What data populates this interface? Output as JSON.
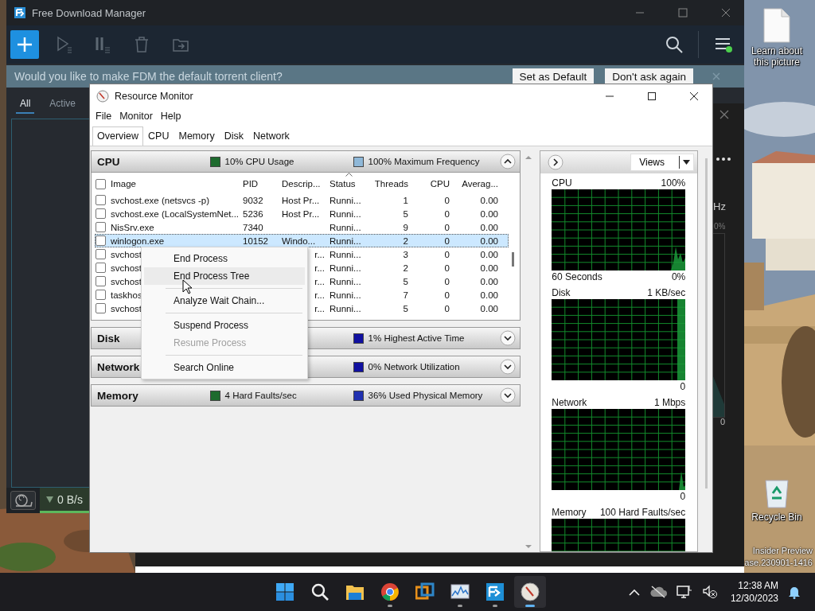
{
  "desktop": {
    "icons": [
      {
        "kind": "file",
        "label": "Learn about this picture"
      },
      {
        "kind": "recycle",
        "label": "Recycle Bin"
      }
    ],
    "build_info": [
      "Insider Preview",
      "ase.230901-1416"
    ]
  },
  "fdm": {
    "title": "Free Download Manager",
    "toolbar": [
      {
        "kind": "add",
        "disabled": false
      },
      {
        "kind": "play",
        "disabled": true
      },
      {
        "kind": "pause",
        "disabled": true
      },
      {
        "kind": "delete",
        "disabled": true
      },
      {
        "kind": "folder",
        "disabled": true
      }
    ],
    "menu_notification": true,
    "banner": {
      "text": "Would you like to make FDM the default torrent client?",
      "buttons": [
        "Set as Default",
        "Don't ask again"
      ]
    },
    "tabs": [
      {
        "label": "All",
        "selected": true
      },
      {
        "label": "Active",
        "selected": false
      }
    ],
    "speed": "0 B/s"
  },
  "back_window": {
    "unit": "Hz",
    "percent": "0%",
    "axis_min": "0"
  },
  "resource_monitor": {
    "title": "Resource Monitor",
    "menu": [
      "File",
      "Monitor",
      "Help"
    ],
    "tabs": [
      {
        "label": "Overview",
        "selected": true
      },
      {
        "label": "CPU",
        "selected": false
      },
      {
        "label": "Memory",
        "selected": false
      },
      {
        "label": "Disk",
        "selected": false
      },
      {
        "label": "Network",
        "selected": false
      }
    ],
    "sections": [
      {
        "title": "CPU",
        "expanded": true,
        "stats": [
          {
            "text": "10% CPU Usage",
            "color": "#1e6b2e"
          },
          {
            "text": "100% Maximum Frequency",
            "color": "#8fb8d8"
          }
        ]
      },
      {
        "title": "Disk",
        "expanded": false,
        "stats": [
          {
            "text": "1% Highest Active Time",
            "color": "#1010a0"
          }
        ]
      },
      {
        "title": "Network",
        "expanded": false,
        "stats": [
          {
            "text": "0% Network Utilization",
            "color": "#1010a0"
          }
        ]
      },
      {
        "title": "Memory",
        "expanded": false,
        "stats": [
          {
            "text": "4 Hard Faults/sec",
            "color": "#1e6b2e"
          },
          {
            "text": "36% Used Physical Memory",
            "color": "#2030b0"
          }
        ]
      }
    ],
    "cpu_table": {
      "all_checked": false,
      "columns": [
        {
          "label": "Image",
          "sorted": false
        },
        {
          "label": "PID",
          "sorted": false
        },
        {
          "label": "Descrip...",
          "sorted": false
        },
        {
          "label": "Status",
          "sorted": true
        },
        {
          "label": "Threads",
          "sorted": false
        },
        {
          "label": "CPU",
          "sorted": false
        },
        {
          "label": "Averag...",
          "sorted": false
        }
      ],
      "rows": [
        {
          "image": "svchost.exe (netsvcs -p)",
          "pid": "9032",
          "description": "Host Pr...",
          "status": "Runni...",
          "threads": "1",
          "cpu": "0",
          "average": "0.00",
          "checked": false,
          "selected": false,
          "partial": false
        },
        {
          "image": "svchost.exe (LocalSystemNet...",
          "pid": "5236",
          "description": "Host Pr...",
          "status": "Runni...",
          "threads": "5",
          "cpu": "0",
          "average": "0.00",
          "checked": false,
          "selected": false,
          "partial": false
        },
        {
          "image": "NisSrv.exe",
          "pid": "7340",
          "status": "Runni...",
          "threads": "9",
          "cpu": "0",
          "average": "0.00",
          "checked": false,
          "selected": false
        },
        {
          "image": "winlogon.exe",
          "pid": "10152",
          "description": "Windo...",
          "status": "Runni...",
          "threads": "2",
          "cpu": "0",
          "average": "0.00",
          "checked": false,
          "selected": true,
          "partial": false
        },
        {
          "image": "svchost",
          "description": "r...",
          "status": "Runni...",
          "threads": "3",
          "cpu": "0",
          "average": "0.00",
          "checked": false,
          "selected": false,
          "partial": true
        },
        {
          "image": "svchost",
          "description": "r...",
          "status": "Runni...",
          "threads": "2",
          "cpu": "0",
          "average": "0.00",
          "checked": false,
          "selected": false,
          "partial": true
        },
        {
          "image": "svchost",
          "description": "r...",
          "status": "Runni...",
          "threads": "5",
          "cpu": "0",
          "average": "0.00",
          "checked": false,
          "selected": false,
          "partial": true
        },
        {
          "image": "taskhos",
          "description": "r...",
          "status": "Runni...",
          "threads": "7",
          "cpu": "0",
          "average": "0.00",
          "checked": false,
          "selected": false,
          "partial": true
        },
        {
          "image": "svchost",
          "description": "r...",
          "status": "Runni...",
          "threads": "5",
          "cpu": "0",
          "average": "0.00",
          "checked": false,
          "selected": false,
          "partial": true
        }
      ]
    },
    "views": "Views",
    "graphs": [
      {
        "title": "CPU",
        "max": "100%",
        "span": "60 Seconds",
        "min": "0%"
      },
      {
        "title": "Disk",
        "max": "1 KB/sec",
        "min": "0"
      },
      {
        "title": "Network",
        "max": "1 Mbps",
        "min": "0"
      },
      {
        "title": "Memory",
        "max": "100 Hard Faults/sec"
      }
    ],
    "context_menu": [
      {
        "kind": "item",
        "label": "End Process",
        "highlighted": false,
        "disabled": false
      },
      {
        "kind": "item",
        "label": "End Process Tree",
        "highlighted": true,
        "disabled": false
      },
      {
        "kind": "separator"
      },
      {
        "kind": "item",
        "label": "Analyze Wait Chain...",
        "highlighted": false,
        "disabled": false
      },
      {
        "kind": "separator"
      },
      {
        "kind": "item",
        "label": "Suspend Process",
        "highlighted": false,
        "disabled": false
      },
      {
        "kind": "item",
        "label": "Resume Process",
        "highlighted": false,
        "disabled": true
      },
      {
        "kind": "separator"
      },
      {
        "kind": "item",
        "label": "Search Online",
        "highlighted": false,
        "disabled": false
      }
    ]
  },
  "taskbar": {
    "apps": [
      {
        "kind": "start",
        "running": false,
        "active": false
      },
      {
        "kind": "search",
        "running": false,
        "active": false
      },
      {
        "kind": "explorer",
        "running": false,
        "active": false
      },
      {
        "kind": "browser",
        "running": true,
        "active": false
      },
      {
        "kind": "vm",
        "running": false,
        "active": false
      },
      {
        "kind": "chart",
        "running": true,
        "active": false
      },
      {
        "kind": "download",
        "running": true,
        "active": false
      },
      {
        "kind": "gauge",
        "running": true,
        "active": true
      }
    ],
    "time": "12:38 AM",
    "date": "12/30/2023"
  }
}
